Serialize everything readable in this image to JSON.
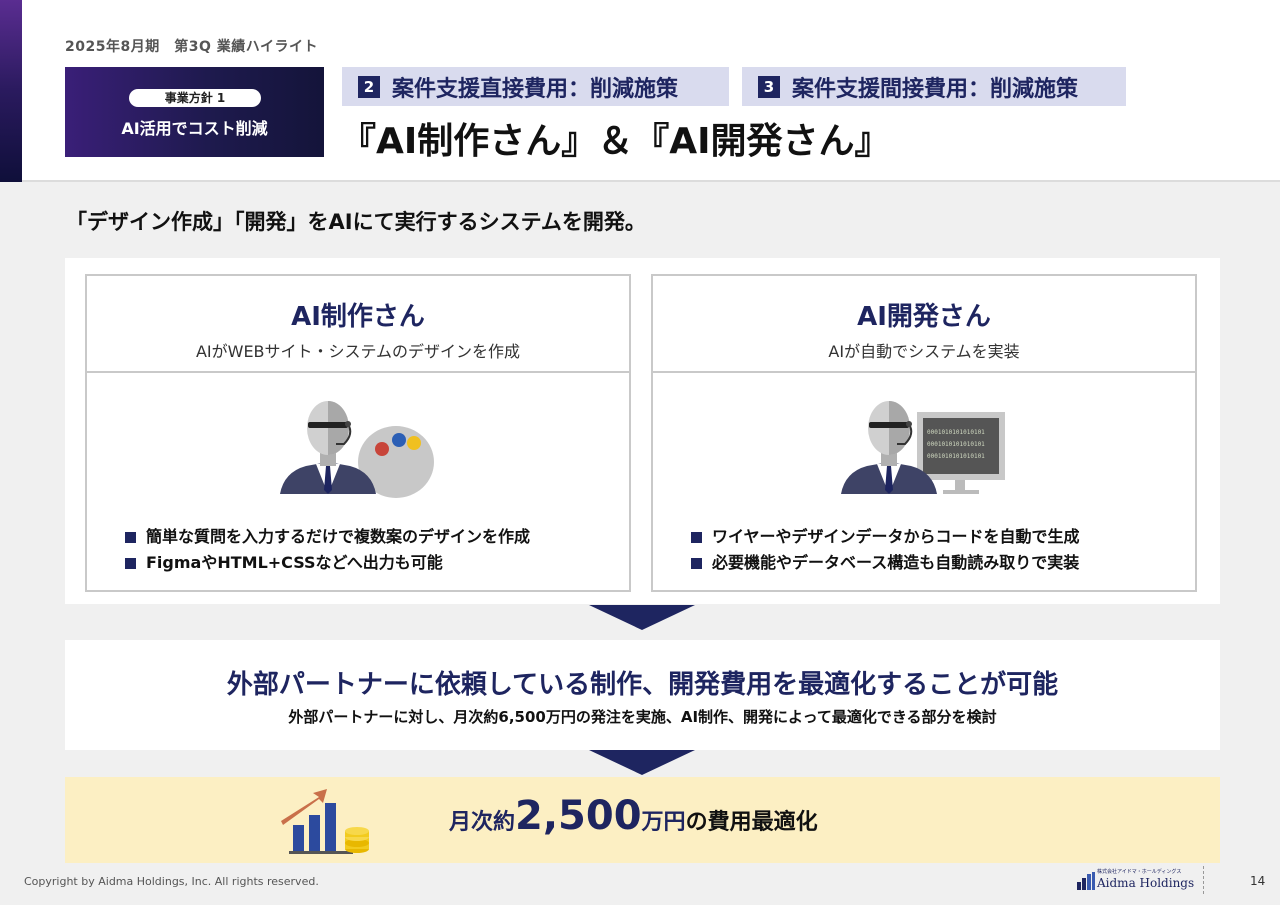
{
  "header": {
    "period": "2025年8月期　第3Q 業績ハイライト",
    "policy_label": "事業方針 1",
    "policy_text": "AI活用でコスト削減",
    "tags": [
      {
        "num": "2",
        "label": "案件支援直接費用：削減施策"
      },
      {
        "num": "3",
        "label": "案件支援間接費用：削減施策"
      }
    ],
    "title": "『AI制作さん』＆『AI開発さん』"
  },
  "lead": "「デザイン作成」「開発」をAIにて実行するシステムを開発。",
  "cards": [
    {
      "title": "AI制作さん",
      "subtitle": "AIがWEBサイト・システムのデザインを作成",
      "icon": "robot-palette-icon",
      "bullets": [
        "簡単な質問を入力するだけで複数案のデザインを作成",
        "FigmaやHTML+CSSなどへ出力も可能"
      ]
    },
    {
      "title": "AI開発さん",
      "subtitle": "AIが自動でシステムを実装",
      "icon": "robot-monitor-icon",
      "monitor_code": [
        "0001010101010101",
        "0001010101010101",
        "0001010101010101"
      ],
      "bullets": [
        "ワイヤーやデザインデータからコードを自動で生成",
        "必要機能やデータベース構造も自動読み取りで実装"
      ]
    }
  ],
  "result": {
    "title": "外部パートナーに依頼している制作、開発費用を最適化することが可能",
    "subtitle": "外部パートナーに対し、月次約6,500万円の発注を実施、AI制作、開発によって最適化できる部分を検討"
  },
  "final": {
    "prefix": "月次約",
    "amount": "2,500",
    "unit": "万円",
    "suffix": "の費用最適化",
    "icon": "growth-chart-coins-icon"
  },
  "footer": {
    "copyright": "Copyright by Aidma Holdings, Inc. All rights reserved.",
    "logo_small": "株式会社アイドマ・ホールディングス",
    "logo_name": "Aidma Holdings",
    "page": "14"
  },
  "colors": {
    "navy": "#1e2560",
    "tag_bg": "#d9dbee",
    "highlight_bg": "#fcefc3",
    "accent_purple": "#5a2d91"
  }
}
